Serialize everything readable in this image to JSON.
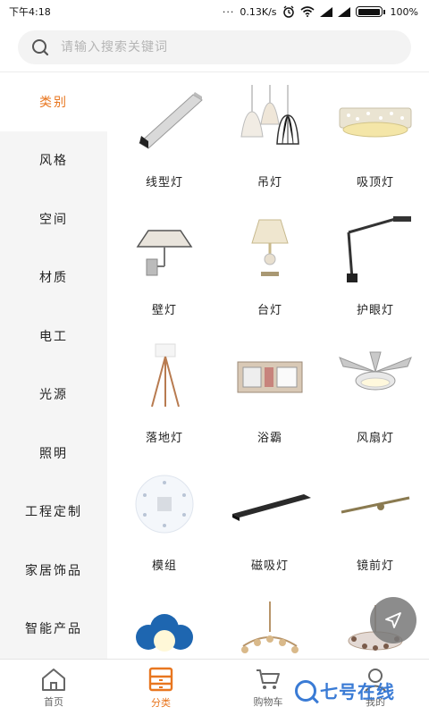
{
  "status_bar": {
    "time": "下午4:18",
    "network_speed": "0.13K/s",
    "battery": "100%"
  },
  "search": {
    "placeholder": "请输入搜索关键词"
  },
  "sidebar": {
    "items": [
      {
        "label": "类别",
        "active": true
      },
      {
        "label": "风格",
        "active": false
      },
      {
        "label": "空间",
        "active": false
      },
      {
        "label": "材质",
        "active": false
      },
      {
        "label": "电工",
        "active": false
      },
      {
        "label": "光源",
        "active": false
      },
      {
        "label": "照明",
        "active": false
      },
      {
        "label": "工程定制",
        "active": false
      },
      {
        "label": "家居饰品",
        "active": false
      },
      {
        "label": "智能产品",
        "active": false
      }
    ]
  },
  "grid": {
    "items": [
      {
        "label": "线型灯",
        "icon": "linear-light-icon"
      },
      {
        "label": "吊灯",
        "icon": "pendant-light-icon"
      },
      {
        "label": "吸顶灯",
        "icon": "ceiling-light-icon"
      },
      {
        "label": "壁灯",
        "icon": "wall-lamp-icon"
      },
      {
        "label": "台灯",
        "icon": "table-lamp-icon"
      },
      {
        "label": "护眼灯",
        "icon": "desk-eye-lamp-icon"
      },
      {
        "label": "落地灯",
        "icon": "floor-lamp-icon"
      },
      {
        "label": "浴霸",
        "icon": "bath-heater-icon"
      },
      {
        "label": "风扇灯",
        "icon": "fan-light-icon"
      },
      {
        "label": "模组",
        "icon": "led-module-icon"
      },
      {
        "label": "磁吸灯",
        "icon": "magnetic-track-light-icon"
      },
      {
        "label": "镜前灯",
        "icon": "mirror-light-icon"
      },
      {
        "label": "",
        "icon": "kids-cloud-lamp-icon"
      },
      {
        "label": "",
        "icon": "crystal-chandelier-icon"
      },
      {
        "label": "",
        "icon": "ornate-chandelier-icon"
      }
    ]
  },
  "bottom_nav": {
    "items": [
      {
        "label": "首页",
        "icon": "home-icon",
        "active": false
      },
      {
        "label": "分类",
        "icon": "category-icon",
        "active": true
      },
      {
        "label": "购物车",
        "icon": "cart-icon",
        "active": false
      },
      {
        "label": "我的",
        "icon": "profile-icon",
        "active": false
      }
    ]
  },
  "watermark": {
    "text": "七号在线"
  },
  "colors": {
    "accent": "#e8761f",
    "sidebar_bg": "#f5f5f5",
    "watermark": "#3a7bd5"
  }
}
